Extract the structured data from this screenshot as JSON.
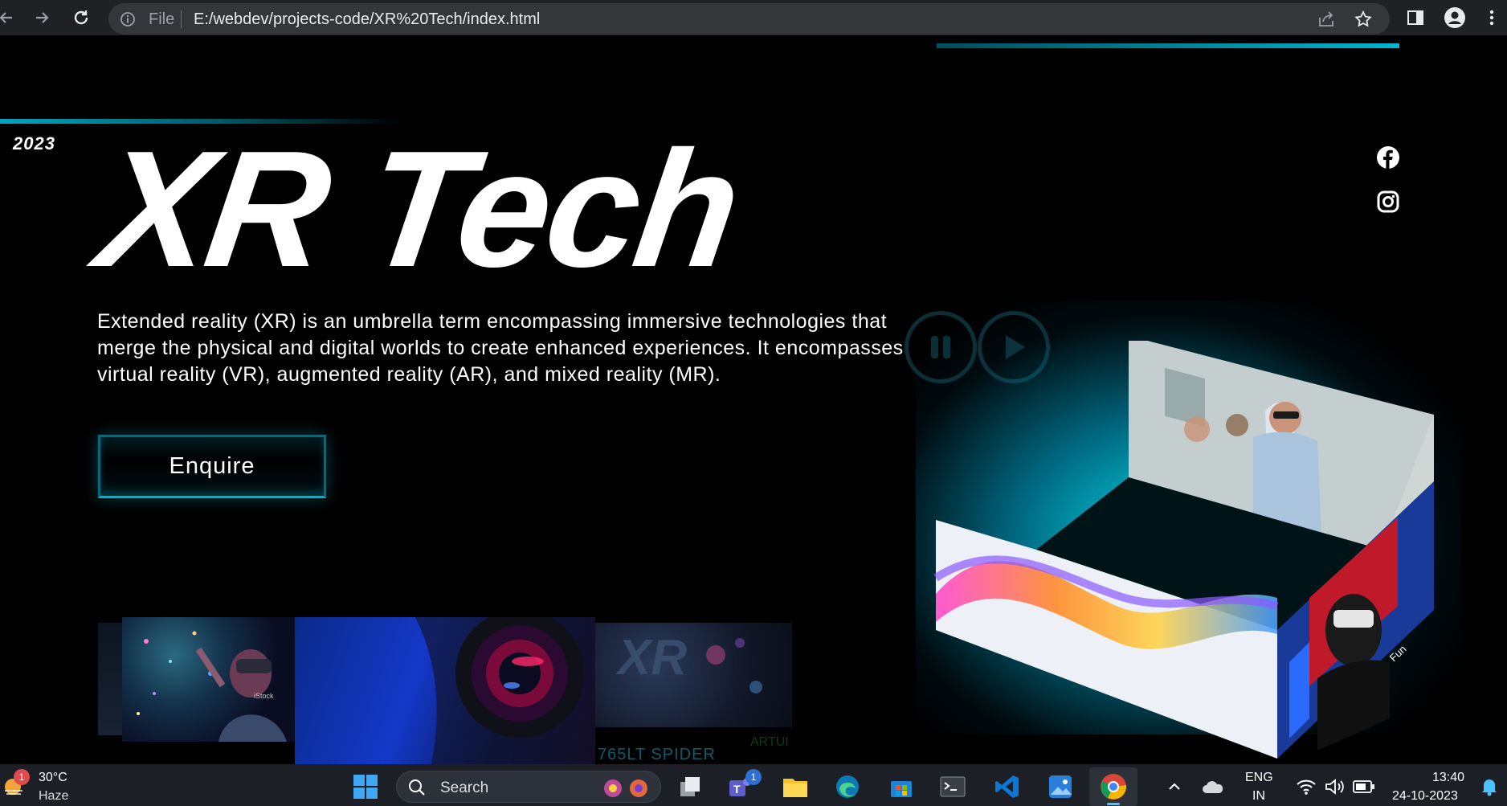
{
  "browser": {
    "omnibox_scheme_label": "File",
    "url": "E:/webdev/projects-code/XR%20Tech/index.html"
  },
  "hero": {
    "year": "2023",
    "title": "XR Tech",
    "description": "Extended reality (XR) is an umbrella term encompassing immersive technologies that merge the physical and digital worlds to create enhanced experiences. It encompasses virtual reality (VR), augmented reality (AR), and mixed reality (MR).",
    "cta_label": "Enquire"
  },
  "gallery": {
    "istock_caption": "iStock",
    "caption_spider": "765LT SPIDER",
    "caption_artu": "ARTUI",
    "xr_logo_text": "XR"
  },
  "cube": {
    "brand_text": "Fun"
  },
  "taskbar": {
    "weather_temp": "30°C",
    "weather_cond": "Haze",
    "weather_badge": "1",
    "search_placeholder": "Search",
    "teams_badge": "1",
    "lang_line1": "ENG",
    "lang_line2": "IN",
    "time": "13:40",
    "date": "24-10-2023"
  },
  "colors": {
    "accent": "#00b4d0",
    "page_bg": "#000000",
    "taskbar_bg": "#1c2026"
  }
}
